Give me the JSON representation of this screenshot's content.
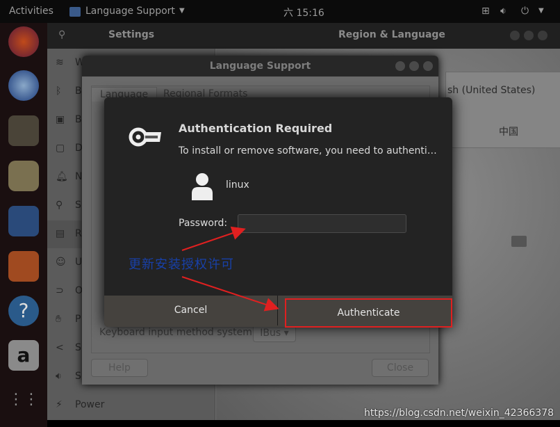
{
  "topbar": {
    "activities": "Activities",
    "app_menu": "Language Support",
    "clock": "六 15:16"
  },
  "dock": {
    "apps": [
      "firefox-icon",
      "thunderbird-icon",
      "files-icon",
      "rhythmbox-icon",
      "writer-icon",
      "software-icon",
      "help-icon",
      "amazon-icon",
      "app-grid-icon"
    ]
  },
  "settings": {
    "title": "Settings",
    "panel_title": "Region & Language",
    "sidebar": [
      {
        "icon": "wifi-icon",
        "label": "W"
      },
      {
        "icon": "bluetooth-icon",
        "label": "B"
      },
      {
        "icon": "background-icon",
        "label": "B"
      },
      {
        "icon": "dock-icon",
        "label": "D"
      },
      {
        "icon": "bell-icon",
        "label": "N"
      },
      {
        "icon": "search-icon",
        "label": "S"
      },
      {
        "icon": "region-icon",
        "label": "R"
      },
      {
        "icon": "accessibility-icon",
        "label": "U"
      },
      {
        "icon": "online-accounts-icon",
        "label": "O"
      },
      {
        "icon": "privacy-icon",
        "label": "P"
      },
      {
        "icon": "share-icon",
        "label": "S"
      },
      {
        "icon": "sound-icon",
        "label": "S"
      },
      {
        "icon": "power-icon",
        "label": "Power"
      }
    ],
    "language_value": "sh (United States)",
    "formats_value": "中国"
  },
  "lang_support": {
    "title": "Language Support",
    "tabs": [
      "Language",
      "Regional Formats"
    ],
    "im_label": "Keyboard input method system:",
    "im_value": "IBus",
    "help": "Help",
    "close": "Close"
  },
  "auth": {
    "title": "Authentication Required",
    "message": "To install or remove software, you need to authenti…",
    "user": "linux",
    "password_label": "Password:",
    "password_value": "",
    "cancel": "Cancel",
    "authenticate": "Authenticate",
    "highlight_color": "#e02020"
  },
  "annotation": "更新安装授权许可",
  "watermark": "https://blog.csdn.net/weixin_42366378"
}
